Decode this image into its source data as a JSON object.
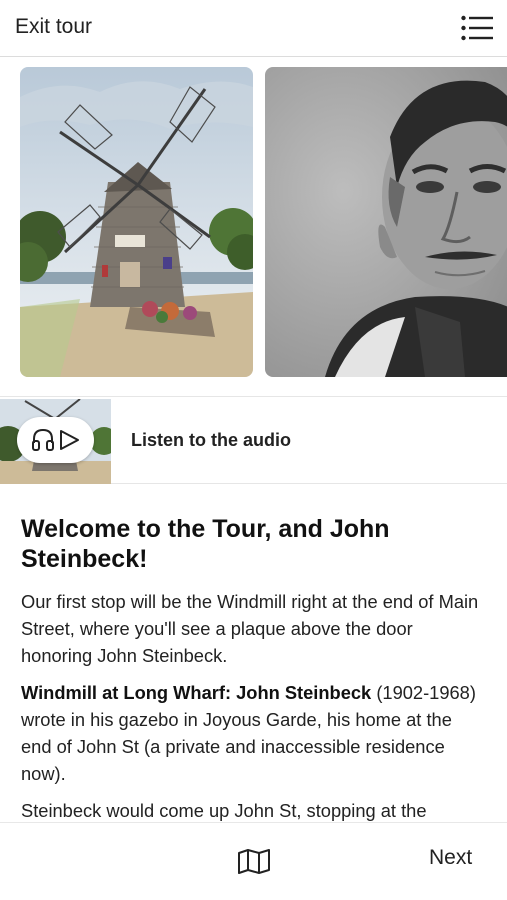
{
  "header": {
    "exit_label": "Exit tour",
    "menu_icon": "list-menu-icon"
  },
  "gallery": {
    "images": [
      {
        "name": "windmill-photo"
      },
      {
        "name": "john-steinbeck-portrait"
      }
    ]
  },
  "audio": {
    "label": "Listen to the audio",
    "icons": [
      "headphones-icon",
      "play-icon"
    ]
  },
  "article": {
    "title": "Welcome to the Tour, and John Steinbeck!",
    "paragraph1": "Our first stop will be the Windmill right at the end of Main Street, where you'll see a plaque above the door honoring John Steinbeck.",
    "paragraph2_bold": "Windmill at Long Wharf: John Steinbeck",
    "paragraph2_rest": " (1902-1968) wrote in his gazebo in Joyous Garde, his home at the end of John St (a private and inaccessible residence now).",
    "paragraph3": "Steinbeck would come up John St, stopping at the"
  },
  "footer": {
    "map_icon": "map-icon",
    "next_label": "Next"
  },
  "colors": {
    "text": "#1a1a1a",
    "divider": "#dcdcdc",
    "background": "#ffffff"
  }
}
